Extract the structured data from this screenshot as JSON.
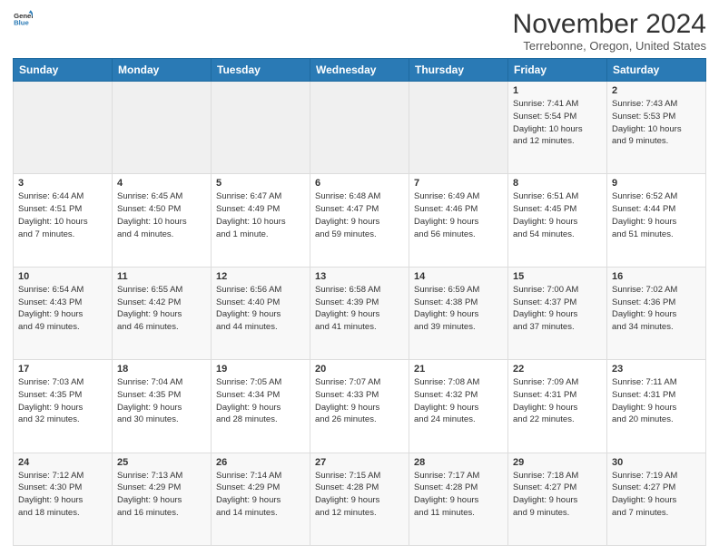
{
  "header": {
    "logo_line1": "General",
    "logo_line2": "Blue",
    "month": "November 2024",
    "location": "Terrebonne, Oregon, United States"
  },
  "days_of_week": [
    "Sunday",
    "Monday",
    "Tuesday",
    "Wednesday",
    "Thursday",
    "Friday",
    "Saturday"
  ],
  "weeks": [
    [
      {
        "day": "",
        "info": ""
      },
      {
        "day": "",
        "info": ""
      },
      {
        "day": "",
        "info": ""
      },
      {
        "day": "",
        "info": ""
      },
      {
        "day": "",
        "info": ""
      },
      {
        "day": "1",
        "info": "Sunrise: 7:41 AM\nSunset: 5:54 PM\nDaylight: 10 hours\nand 12 minutes."
      },
      {
        "day": "2",
        "info": "Sunrise: 7:43 AM\nSunset: 5:53 PM\nDaylight: 10 hours\nand 9 minutes."
      }
    ],
    [
      {
        "day": "3",
        "info": "Sunrise: 6:44 AM\nSunset: 4:51 PM\nDaylight: 10 hours\nand 7 minutes."
      },
      {
        "day": "4",
        "info": "Sunrise: 6:45 AM\nSunset: 4:50 PM\nDaylight: 10 hours\nand 4 minutes."
      },
      {
        "day": "5",
        "info": "Sunrise: 6:47 AM\nSunset: 4:49 PM\nDaylight: 10 hours\nand 1 minute."
      },
      {
        "day": "6",
        "info": "Sunrise: 6:48 AM\nSunset: 4:47 PM\nDaylight: 9 hours\nand 59 minutes."
      },
      {
        "day": "7",
        "info": "Sunrise: 6:49 AM\nSunset: 4:46 PM\nDaylight: 9 hours\nand 56 minutes."
      },
      {
        "day": "8",
        "info": "Sunrise: 6:51 AM\nSunset: 4:45 PM\nDaylight: 9 hours\nand 54 minutes."
      },
      {
        "day": "9",
        "info": "Sunrise: 6:52 AM\nSunset: 4:44 PM\nDaylight: 9 hours\nand 51 minutes."
      }
    ],
    [
      {
        "day": "10",
        "info": "Sunrise: 6:54 AM\nSunset: 4:43 PM\nDaylight: 9 hours\nand 49 minutes."
      },
      {
        "day": "11",
        "info": "Sunrise: 6:55 AM\nSunset: 4:42 PM\nDaylight: 9 hours\nand 46 minutes."
      },
      {
        "day": "12",
        "info": "Sunrise: 6:56 AM\nSunset: 4:40 PM\nDaylight: 9 hours\nand 44 minutes."
      },
      {
        "day": "13",
        "info": "Sunrise: 6:58 AM\nSunset: 4:39 PM\nDaylight: 9 hours\nand 41 minutes."
      },
      {
        "day": "14",
        "info": "Sunrise: 6:59 AM\nSunset: 4:38 PM\nDaylight: 9 hours\nand 39 minutes."
      },
      {
        "day": "15",
        "info": "Sunrise: 7:00 AM\nSunset: 4:37 PM\nDaylight: 9 hours\nand 37 minutes."
      },
      {
        "day": "16",
        "info": "Sunrise: 7:02 AM\nSunset: 4:36 PM\nDaylight: 9 hours\nand 34 minutes."
      }
    ],
    [
      {
        "day": "17",
        "info": "Sunrise: 7:03 AM\nSunset: 4:35 PM\nDaylight: 9 hours\nand 32 minutes."
      },
      {
        "day": "18",
        "info": "Sunrise: 7:04 AM\nSunset: 4:35 PM\nDaylight: 9 hours\nand 30 minutes."
      },
      {
        "day": "19",
        "info": "Sunrise: 7:05 AM\nSunset: 4:34 PM\nDaylight: 9 hours\nand 28 minutes."
      },
      {
        "day": "20",
        "info": "Sunrise: 7:07 AM\nSunset: 4:33 PM\nDaylight: 9 hours\nand 26 minutes."
      },
      {
        "day": "21",
        "info": "Sunrise: 7:08 AM\nSunset: 4:32 PM\nDaylight: 9 hours\nand 24 minutes."
      },
      {
        "day": "22",
        "info": "Sunrise: 7:09 AM\nSunset: 4:31 PM\nDaylight: 9 hours\nand 22 minutes."
      },
      {
        "day": "23",
        "info": "Sunrise: 7:11 AM\nSunset: 4:31 PM\nDaylight: 9 hours\nand 20 minutes."
      }
    ],
    [
      {
        "day": "24",
        "info": "Sunrise: 7:12 AM\nSunset: 4:30 PM\nDaylight: 9 hours\nand 18 minutes."
      },
      {
        "day": "25",
        "info": "Sunrise: 7:13 AM\nSunset: 4:29 PM\nDaylight: 9 hours\nand 16 minutes."
      },
      {
        "day": "26",
        "info": "Sunrise: 7:14 AM\nSunset: 4:29 PM\nDaylight: 9 hours\nand 14 minutes."
      },
      {
        "day": "27",
        "info": "Sunrise: 7:15 AM\nSunset: 4:28 PM\nDaylight: 9 hours\nand 12 minutes."
      },
      {
        "day": "28",
        "info": "Sunrise: 7:17 AM\nSunset: 4:28 PM\nDaylight: 9 hours\nand 11 minutes."
      },
      {
        "day": "29",
        "info": "Sunrise: 7:18 AM\nSunset: 4:27 PM\nDaylight: 9 hours\nand 9 minutes."
      },
      {
        "day": "30",
        "info": "Sunrise: 7:19 AM\nSunset: 4:27 PM\nDaylight: 9 hours\nand 7 minutes."
      }
    ]
  ]
}
